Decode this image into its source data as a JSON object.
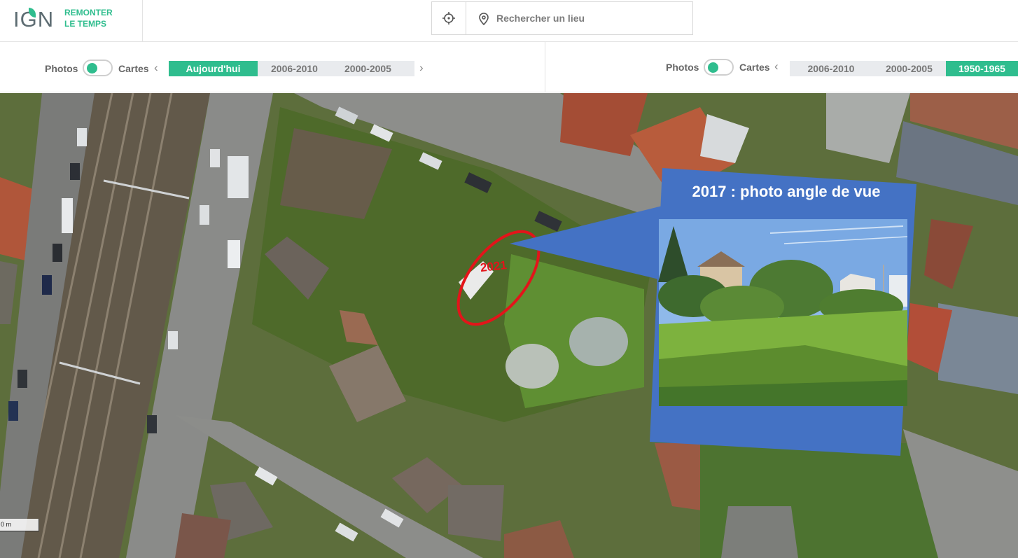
{
  "app": {
    "logo_ign": "IGN",
    "logo_line1": "REMONTER",
    "logo_line2": "LE TEMPS"
  },
  "search": {
    "placeholder": "Rechercher un lieu",
    "locate_icon": "crosshair-icon",
    "pin_icon": "map-pin-icon"
  },
  "left_panel": {
    "photos_label": "Photos",
    "cartes_label": "Cartes",
    "toggle_mode": "photos",
    "periods": [
      "Aujourd'hui",
      "2006-2010",
      "2000-2005"
    ],
    "active_period": "Aujourd'hui"
  },
  "right_panel": {
    "photos_label": "Photos",
    "cartes_label": "Cartes",
    "toggle_mode": "photos",
    "periods": [
      "2006-2010",
      "2000-2005",
      "1950-1965"
    ],
    "active_period": "1950-1965"
  },
  "map": {
    "scale_label": "0 m",
    "annotation_year": "2021",
    "callout_title": "2017 : photo angle de vue"
  },
  "colors": {
    "accent": "#2fbd8e",
    "callout_blue": "#4472c4",
    "annotation_red": "#e3141a"
  }
}
